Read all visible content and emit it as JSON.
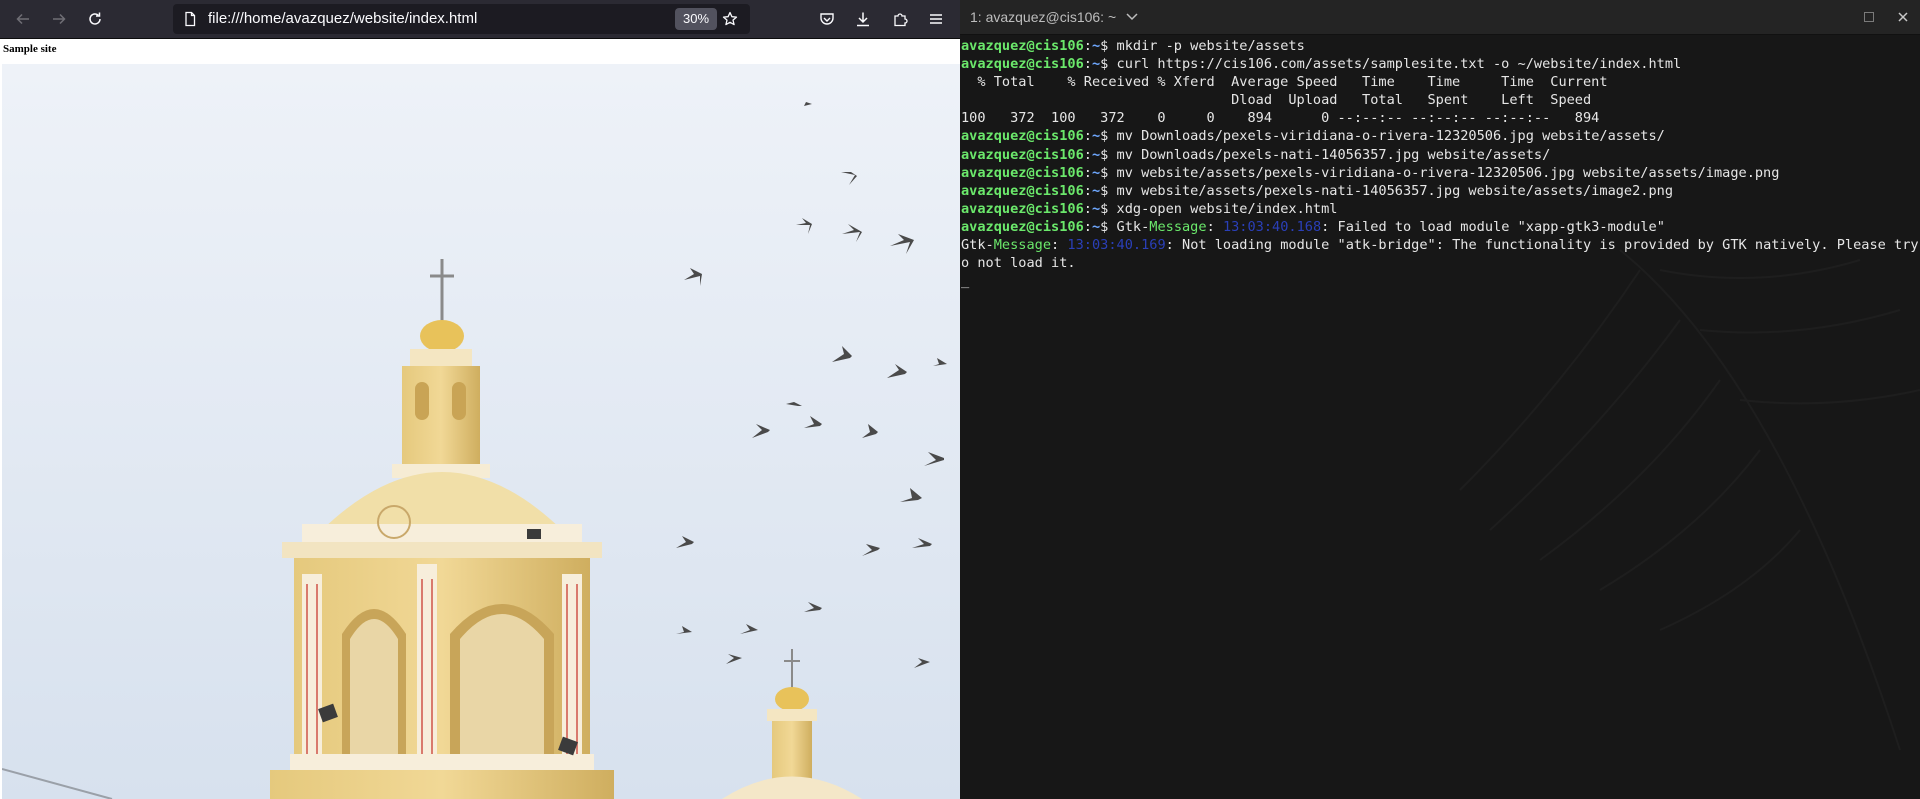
{
  "browser": {
    "url": "file:///home/avazquez/website/index.html",
    "zoom": "30%",
    "page": {
      "heading": "Sample site"
    }
  },
  "terminal": {
    "title": "1: avazquez@cis106: ~",
    "user_host": "avazquez@cis106",
    "path": "~",
    "lines": [
      {
        "cmd": "mkdir -p website/assets"
      },
      {
        "cmd": "curl https://cis106.com/assets/samplesite.txt -o ~/website/index.html"
      },
      {
        "text": "  % Total    % Received % Xferd  Average Speed   Time    Time     Time  Current"
      },
      {
        "text": "                                 Dload  Upload   Total   Spent    Left  Speed"
      },
      {
        "text": "100   372  100   372    0     0    894      0 --:--:-- --:--:-- --:--:--   894"
      },
      {
        "cmd": "mv Downloads/pexels-viridiana-o-rivera-12320506.jpg website/assets/"
      },
      {
        "cmd": "mv Downloads/pexels-nati-14056357.jpg website/assets/"
      },
      {
        "cmd": "mv website/assets/pexels-viridiana-o-rivera-12320506.jpg website/assets/image.png"
      },
      {
        "cmd": "mv website/assets/pexels-nati-14056357.jpg website/assets/image2.png"
      },
      {
        "cmd": "xdg-open website/index.html"
      },
      {
        "gtk_prompt": true,
        "timestamp": "13:03:40.168",
        "msg": ": Failed to load module \"xapp-gtk3-module\""
      },
      {
        "gtk": true,
        "timestamp": "13:03:40.169",
        "msg": ": Not loading module \"atk-bridge\": The functionality is provided by GTK natively. Please try t"
      },
      {
        "text": "o not load it."
      },
      {
        "text": "_"
      }
    ]
  },
  "colors": {
    "prompt_user": "#6be86b",
    "prompt_path": "#6fa8ff",
    "terminal_bg": "#171717",
    "browser_toolbar": "#2b2a33"
  }
}
